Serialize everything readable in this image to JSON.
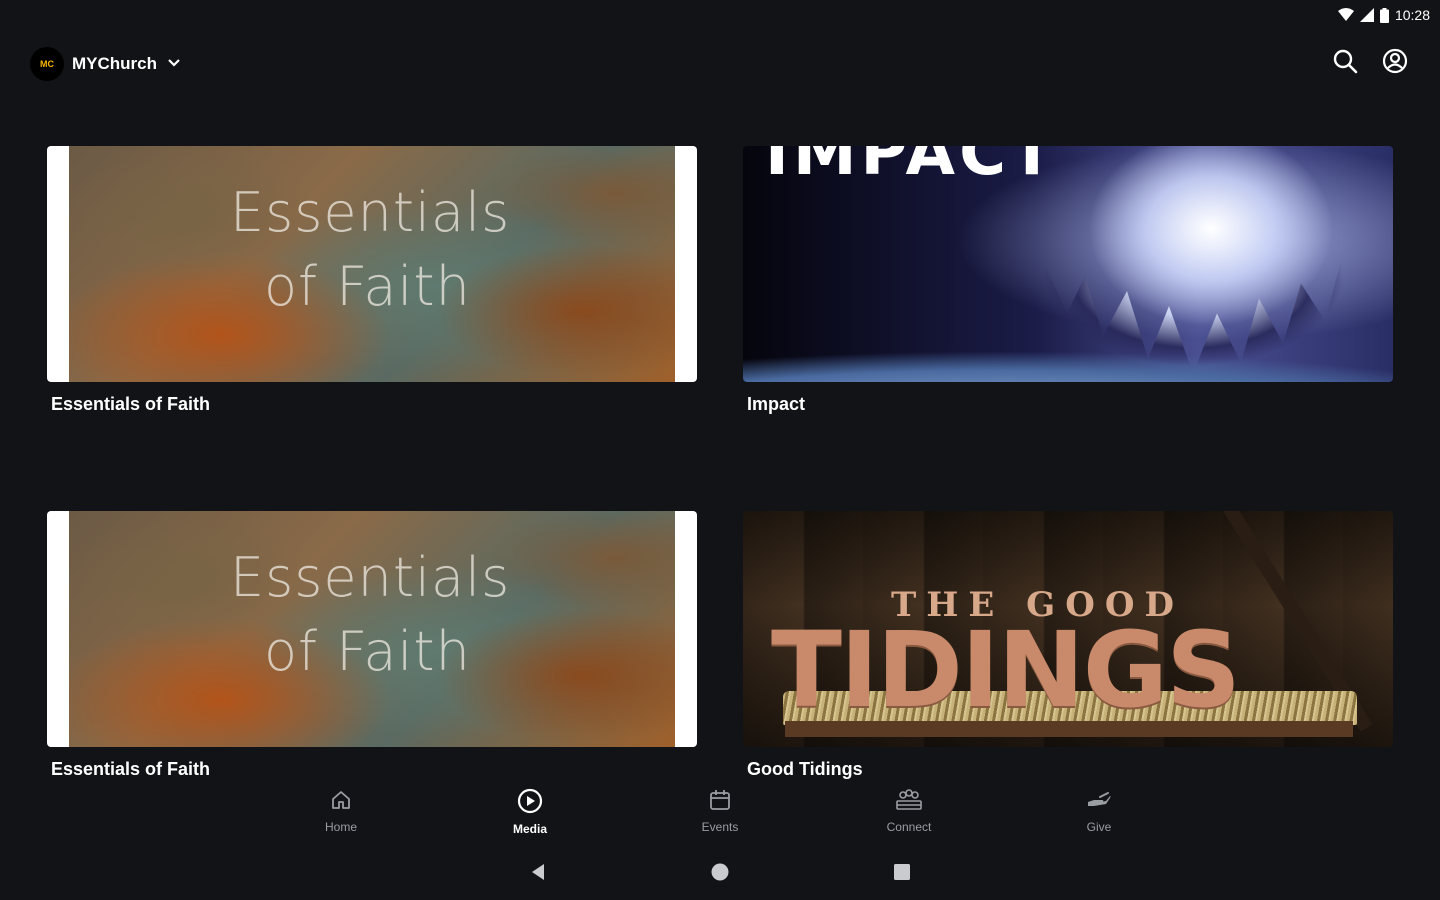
{
  "status_bar": {
    "time": "10:28"
  },
  "app_bar": {
    "logo_text": "MC",
    "church_name": "MYChurch"
  },
  "media": [
    {
      "title": "Essentials of Faith",
      "art_line1": "Essentials",
      "art_line2": "of Faith"
    },
    {
      "title": "Impact",
      "art_word": "IMPACT"
    },
    {
      "title": "Essentials of Faith",
      "art_line1": "Essentials",
      "art_line2": "of Faith"
    },
    {
      "title": "Good Tidings",
      "art_line1": "THE GOOD",
      "art_line2": "TIDINGS"
    }
  ],
  "bottom_nav": {
    "active": "Media",
    "items": [
      {
        "label": "Home",
        "icon": "home-icon"
      },
      {
        "label": "Media",
        "icon": "play-circle-icon"
      },
      {
        "label": "Events",
        "icon": "calendar-icon"
      },
      {
        "label": "Connect",
        "icon": "group-icon"
      },
      {
        "label": "Give",
        "icon": "give-hand-icon"
      }
    ]
  },
  "colors": {
    "background": "#111316",
    "nav_inactive": "#9a9da2",
    "nav_active": "#ffffff"
  }
}
